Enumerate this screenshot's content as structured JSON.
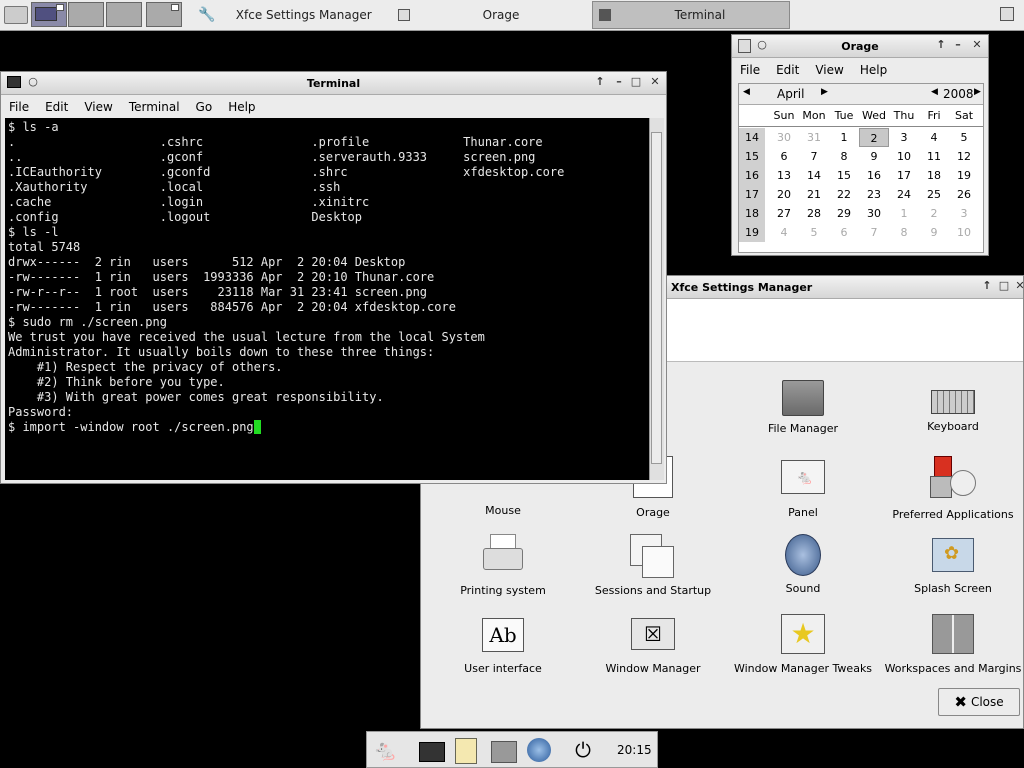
{
  "top_panel": {
    "tasks": [
      {
        "label": "Xfce Settings Manager"
      },
      {
        "label": "Orage"
      },
      {
        "label": "Terminal"
      }
    ]
  },
  "terminal": {
    "title": "Terminal",
    "menu": [
      "File",
      "Edit",
      "View",
      "Terminal",
      "Go",
      "Help"
    ],
    "lines": [
      "$ ls -a",
      ".                    .cshrc               .profile             Thunar.core",
      "..                   .gconf               .serverauth.9333     screen.png",
      ".ICEauthority        .gconfd              .shrc                xfdesktop.core",
      ".Xauthority          .local               .ssh",
      ".cache               .login               .xinitrc",
      ".config              .logout              Desktop",
      "$ ls -l",
      "total 5748",
      "drwx------  2 rin   users      512 Apr  2 20:04 Desktop",
      "-rw-------  1 rin   users  1993336 Apr  2 20:10 Thunar.core",
      "-rw-r--r--  1 root  users    23118 Mar 31 23:41 screen.png",
      "-rw-------  1 rin   users   884576 Apr  2 20:04 xfdesktop.core",
      "$ sudo rm ./screen.png",
      "",
      "We trust you have received the usual lecture from the local System",
      "Administrator. It usually boils down to these three things:",
      "",
      "    #1) Respect the privacy of others.",
      "    #2) Think before you type.",
      "    #3) With great power comes great responsibility.",
      "",
      "Password:",
      "$ import -window root ./screen.png"
    ]
  },
  "orage": {
    "title": "Orage",
    "menu": [
      "File",
      "Edit",
      "View",
      "Help"
    ],
    "month": "April",
    "year": "2008",
    "weekdays": [
      "Sun",
      "Mon",
      "Tue",
      "Wed",
      "Thu",
      "Fri",
      "Sat"
    ],
    "weeks": [
      {
        "wk": "14",
        "days": [
          "30",
          "31",
          "1",
          "2",
          "3",
          "4",
          "5"
        ]
      },
      {
        "wk": "15",
        "days": [
          "6",
          "7",
          "8",
          "9",
          "10",
          "11",
          "12"
        ]
      },
      {
        "wk": "16",
        "days": [
          "13",
          "14",
          "15",
          "16",
          "17",
          "18",
          "19"
        ]
      },
      {
        "wk": "17",
        "days": [
          "20",
          "21",
          "22",
          "23",
          "24",
          "25",
          "26"
        ]
      },
      {
        "wk": "18",
        "days": [
          "27",
          "28",
          "29",
          "30",
          "1",
          "2",
          "3"
        ]
      },
      {
        "wk": "19",
        "days": [
          "4",
          "5",
          "6",
          "7",
          "8",
          "9",
          "10"
        ]
      }
    ],
    "selected_day": "2"
  },
  "settings": {
    "title": "Xfce Settings Manager",
    "items": [
      {
        "label": "File Manager",
        "icon": "file-manager-icon"
      },
      {
        "label": "Keyboard",
        "icon": "keyboard-icon"
      },
      {
        "label": "Mouse",
        "icon": "mouse-icon"
      },
      {
        "label": "Orage",
        "icon": "orage-icon"
      },
      {
        "label": "Panel",
        "icon": "panel-icon"
      },
      {
        "label": "Preferred Applications",
        "icon": "preferred-applications-icon"
      },
      {
        "label": "Printing system",
        "icon": "printer-icon"
      },
      {
        "label": "Sessions and Startup",
        "icon": "sessions-icon"
      },
      {
        "label": "Sound",
        "icon": "speaker-icon"
      },
      {
        "label": "Splash Screen",
        "icon": "splash-icon"
      },
      {
        "label": "User interface",
        "icon": "user-interface-icon"
      },
      {
        "label": "Window Manager",
        "icon": "window-manager-icon"
      },
      {
        "label": "Window Manager Tweaks",
        "icon": "star-icon"
      },
      {
        "label": "Workspaces and Margins",
        "icon": "workspaces-icon"
      }
    ],
    "close_label": "Close"
  },
  "bottom_panel": {
    "clock": "20:15"
  }
}
